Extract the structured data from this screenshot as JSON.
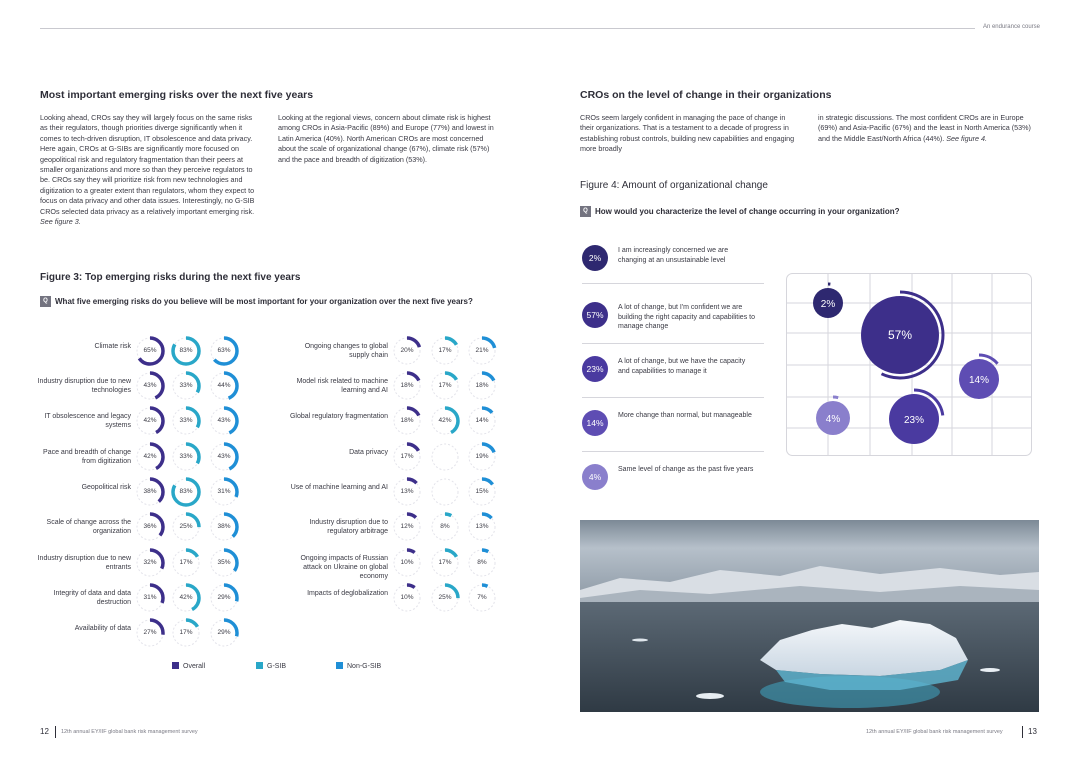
{
  "header": {
    "tagline": "An endurance course"
  },
  "left": {
    "section_title": "Most important emerging risks over the next five years",
    "para1": "Looking ahead, CROs say they will largely focus on the same risks as their regulators, though priorities diverge significantly when it comes to tech-driven disruption, IT obsolescence and data privacy. Here again, CROs at G-SIBs are significantly more focused on geopolitical risk and regulatory fragmentation than their peers at smaller organizations and more so than they perceive regulators to be. CROs say they will prioritize risk from new technologies and digitization to a greater extent than regulators, whom they expect to focus on data privacy and other data issues. Interestingly, no G-SIB CROs selected data privacy as a relatively important emerging risk.",
    "para1_ref": "See figure 3.",
    "para2": "Looking at the regional views, concern about climate risk is highest among CROs in Asia-Pacific (89%) and Europe (77%) and lowest in Latin America (40%). North American CROs are most concerned about the scale of organizational change (67%), climate risk (57%) and the pace and breadth of digitization (53%).",
    "figure_title": "Figure 3: Top emerging risks during the next five years",
    "q_badge": "Q",
    "question": "What five emerging risks do you believe will be most important for your organization over the next five years?",
    "legend": {
      "overall": "Overall",
      "gsib": "G-SIB",
      "non_gsib": "Non-G-SIB"
    },
    "colors": {
      "overall": "#3d2f8a",
      "gsib": "#29a7c8",
      "non_gsib": "#1f8fd6",
      "track": "#e3e3ea"
    },
    "risks_col1": [
      {
        "label": "Climate risk",
        "values": [
          "65%",
          "83%",
          "63%"
        ],
        "fractions": [
          0.65,
          0.83,
          0.63
        ]
      },
      {
        "label": "Industry disruption due to new technologies",
        "values": [
          "43%",
          "33%",
          "44%"
        ],
        "fractions": [
          0.43,
          0.33,
          0.44
        ]
      },
      {
        "label": "IT obsolescence and legacy systems",
        "values": [
          "42%",
          "33%",
          "43%"
        ],
        "fractions": [
          0.42,
          0.33,
          0.43
        ]
      },
      {
        "label": "Pace and breadth of change from digitization",
        "values": [
          "42%",
          "33%",
          "43%"
        ],
        "fractions": [
          0.42,
          0.33,
          0.43
        ]
      },
      {
        "label": "Geopolitical risk",
        "values": [
          "38%",
          "83%",
          "31%"
        ],
        "fractions": [
          0.38,
          0.83,
          0.31
        ]
      },
      {
        "label": "Scale of change across the organization",
        "values": [
          "36%",
          "25%",
          "38%"
        ],
        "fractions": [
          0.36,
          0.25,
          0.38
        ]
      },
      {
        "label": "Industry disruption due to new entrants",
        "values": [
          "32%",
          "17%",
          "35%"
        ],
        "fractions": [
          0.32,
          0.17,
          0.35
        ]
      },
      {
        "label": "Integrity of data and data destruction",
        "values": [
          "31%",
          "42%",
          "29%"
        ],
        "fractions": [
          0.31,
          0.42,
          0.29
        ]
      },
      {
        "label": "Availability of data",
        "values": [
          "27%",
          "17%",
          "29%"
        ],
        "fractions": [
          0.27,
          0.17,
          0.29
        ]
      }
    ],
    "risks_col2": [
      {
        "label": "Ongoing changes to global supply chain",
        "values": [
          "20%",
          "17%",
          "21%"
        ],
        "fractions": [
          0.2,
          0.17,
          0.21
        ]
      },
      {
        "label": "Model risk related to machine learning and AI",
        "values": [
          "18%",
          "17%",
          "18%"
        ],
        "fractions": [
          0.18,
          0.17,
          0.18
        ]
      },
      {
        "label": "Global regulatory fragmentation",
        "values": [
          "18%",
          "42%",
          "14%"
        ],
        "fractions": [
          0.18,
          0.42,
          0.14
        ]
      },
      {
        "label": "Data privacy",
        "values": [
          "17%",
          "",
          "19%"
        ],
        "fractions": [
          0.17,
          0,
          0.19
        ]
      },
      {
        "label": "Use of machine learning and AI",
        "values": [
          "13%",
          "",
          "15%"
        ],
        "fractions": [
          0.13,
          0,
          0.15
        ]
      },
      {
        "label": "Industry disruption due to regulatory arbitrage",
        "values": [
          "12%",
          "8%",
          "13%"
        ],
        "fractions": [
          0.12,
          0.08,
          0.13
        ]
      },
      {
        "label": "Ongoing impacts of Russian attack on Ukraine on global economy",
        "values": [
          "10%",
          "17%",
          "8%"
        ],
        "fractions": [
          0.1,
          0.17,
          0.08
        ]
      },
      {
        "label": "Impacts of deglobalization",
        "values": [
          "10%",
          "25%",
          "7%"
        ],
        "fractions": [
          0.1,
          0.25,
          0.07
        ]
      }
    ]
  },
  "right": {
    "section_title": "CROs on the level of change in their organizations",
    "para1": "CROs seem largely confident in managing the pace of change in their organizations. That is a testament to a decade of progress in establishing robust controls, building new capabilities and engaging more broadly",
    "para2": "in strategic discussions. The most confident CROs are in Europe (69%) and Asia-Pacific (67%) and the least in North America (53%) and the Middle East/North Africa (44%).",
    "para2_ref": "See figure 4.",
    "figure_title": "Figure 4: Amount of organizational change",
    "q_badge": "Q",
    "question": "How would you characterize the level of change occurring in your organization?",
    "chart_data": {
      "type": "bubble",
      "items": [
        {
          "value": "2%",
          "fraction": 0.02,
          "label": "I am increasingly concerned we are changing at an unsustainable level",
          "color": "#2e2870"
        },
        {
          "value": "57%",
          "fraction": 0.57,
          "label": "A lot of change, but I'm confident we are building the right capacity and capabilities to manage change",
          "color": "#3d2f8a"
        },
        {
          "value": "23%",
          "fraction": 0.23,
          "label": "A lot of change, but we have the capacity and capabilities to manage it",
          "color": "#4a3aa0"
        },
        {
          "value": "14%",
          "fraction": 0.14,
          "label": "More change than normal, but manageable",
          "color": "#5e4db3"
        },
        {
          "value": "4%",
          "fraction": 0.04,
          "label": "Same level of change as the past five years",
          "color": "#8a7fcc"
        }
      ]
    }
  },
  "footer": {
    "left_page": "12",
    "left_text": "12th annual EY/IIF global bank risk management survey",
    "right_text": "12th annual EY/IIF global bank risk management survey",
    "right_page": "13"
  }
}
